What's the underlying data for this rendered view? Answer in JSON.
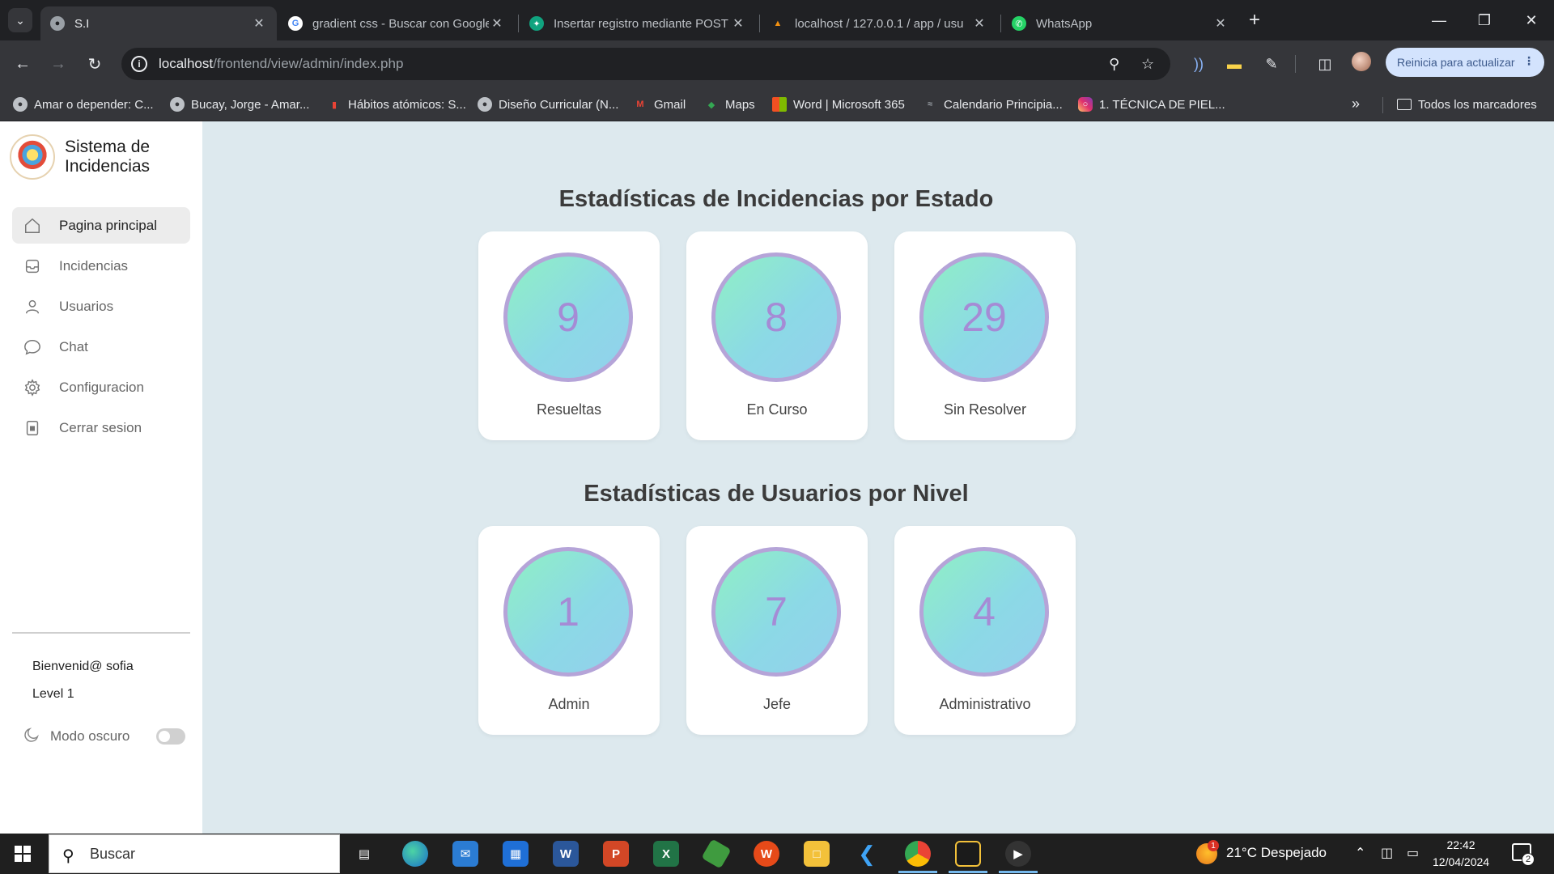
{
  "browser": {
    "tabs": [
      {
        "title": "S.I",
        "active": true
      },
      {
        "title": "gradient css - Buscar con Google"
      },
      {
        "title": "Insertar registro mediante POST"
      },
      {
        "title": "localhost / 127.0.0.1 / app / usu"
      },
      {
        "title": "WhatsApp"
      }
    ],
    "url_host": "localhost",
    "url_path": "/frontend/view/admin/index.php",
    "update_button": "Reinicia para actualizar",
    "bookmarks": [
      "Amar o depender: C...",
      "Bucay, Jorge - Amar...",
      "Hábitos atómicos: S...",
      "Diseño Curricular (N...",
      "Gmail",
      "Maps",
      "Word | Microsoft 365",
      "Calendario Principia...",
      "1. TÉCNICA DE PIEL..."
    ],
    "all_bookmarks": "Todos los marcadores"
  },
  "sidebar": {
    "title": "Sistema de Incidencias",
    "items": [
      {
        "label": "Pagina principal",
        "icon": "home-icon"
      },
      {
        "label": "Incidencias",
        "icon": "inbox-icon"
      },
      {
        "label": "Usuarios",
        "icon": "user-icon"
      },
      {
        "label": "Chat",
        "icon": "chat-icon"
      },
      {
        "label": "Configuracion",
        "icon": "gear-icon"
      },
      {
        "label": "Cerrar sesion",
        "icon": "lock-icon"
      }
    ],
    "welcome": "Bienvenid@ sofia",
    "level": "Level 1",
    "dark_mode": "Modo oscuro"
  },
  "main": {
    "incidents_title": "Estadísticas de Incidencias por Estado",
    "incidents": [
      {
        "value": "9",
        "label": "Resueltas"
      },
      {
        "value": "8",
        "label": "En Curso"
      },
      {
        "value": "29",
        "label": "Sin Resolver"
      }
    ],
    "users_title": "Estadísticas de Usuarios por Nivel",
    "users": [
      {
        "value": "1",
        "label": "Admin"
      },
      {
        "value": "7",
        "label": "Jefe"
      },
      {
        "value": "4",
        "label": "Administrativo"
      }
    ]
  },
  "taskbar": {
    "search_placeholder": "Buscar",
    "weather": "21°C  Despejado",
    "weather_badge": "1",
    "time": "22:42",
    "date": "12/04/2024",
    "notifications": "2"
  },
  "colors": {
    "page_bg": "#dde9ee",
    "ring_border": "#b5a4d8",
    "ring_gradient_start": "#8ff0c4",
    "ring_gradient_end": "#93d0ec",
    "number_color": "#a58bd5"
  }
}
